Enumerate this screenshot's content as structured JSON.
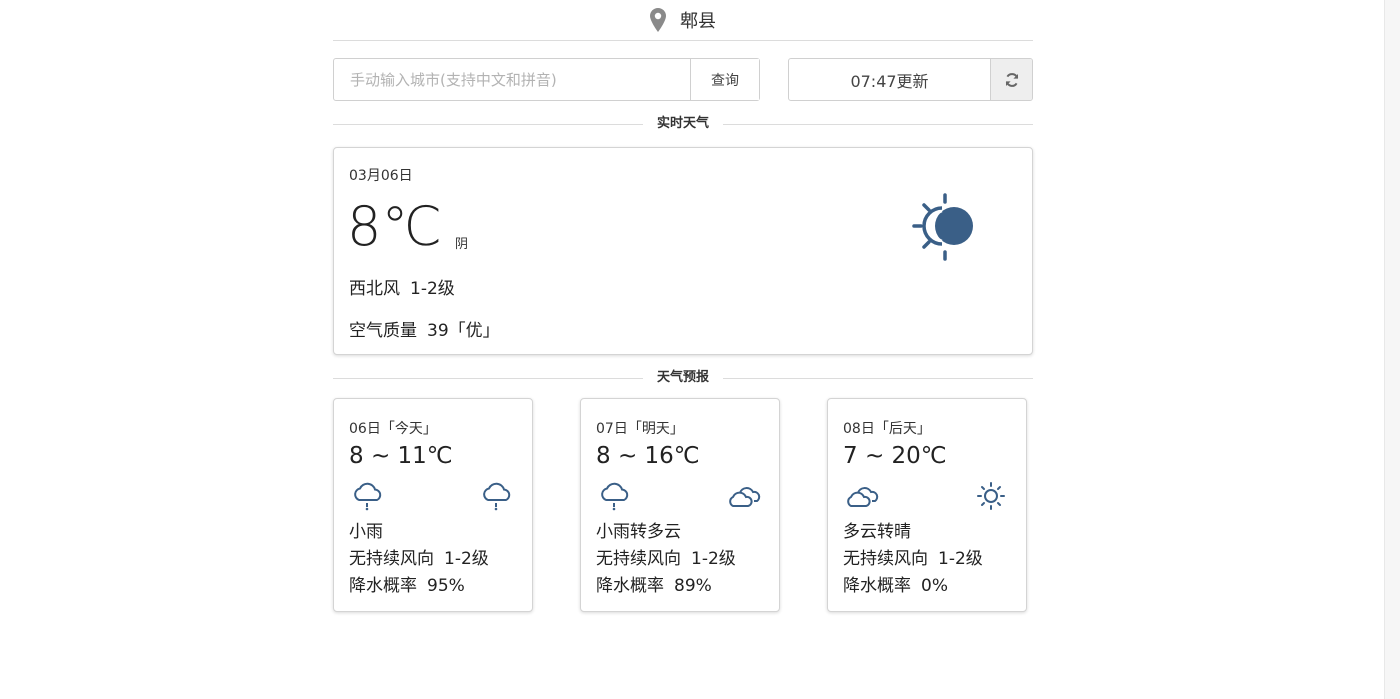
{
  "header": {
    "city": "郫县",
    "location_icon": "map-pin-icon"
  },
  "search": {
    "placeholder": "手动输入城市(支持中文和拼音)",
    "value": "",
    "button_label": "查询"
  },
  "update": {
    "text": "07:47更新",
    "refresh_icon": "refresh-icon"
  },
  "sections": {
    "current_title": "实时天气",
    "forecast_title": "天气预报"
  },
  "current": {
    "date": "03月06日",
    "temperature": "8℃",
    "description": "阴",
    "wind_direction": "西北风",
    "wind_level": "1-2级",
    "aqi_label": "空气质量",
    "aqi_value": "39「优」",
    "icon": "partly-sunny-icon"
  },
  "forecast": [
    {
      "date": "06日「今天」",
      "temp_range": "8 ~ 11℃",
      "day_icon": "light-rain-icon",
      "night_icon": "light-rain-icon",
      "weather": "小雨",
      "wind_direction": "无持续风向",
      "wind_level": "1-2级",
      "rain_label": "降水概率",
      "rain_prob": "95%"
    },
    {
      "date": "07日「明天」",
      "temp_range": "8 ~ 16℃",
      "day_icon": "light-rain-icon",
      "night_icon": "cloudy-icon",
      "weather": "小雨转多云",
      "wind_direction": "无持续风向",
      "wind_level": "1-2级",
      "rain_label": "降水概率",
      "rain_prob": "89%"
    },
    {
      "date": "08日「后天」",
      "temp_range": "7 ~ 20℃",
      "day_icon": "cloudy-icon",
      "night_icon": "sunny-icon",
      "weather": "多云转晴",
      "wind_direction": "无持续风向",
      "wind_level": "1-2级",
      "rain_label": "降水概率",
      "rain_prob": "0%"
    }
  ],
  "colors": {
    "icon_blue": "#3a5f87",
    "pin_gray": "#8a8a8a",
    "border": "#d4d4d4"
  }
}
